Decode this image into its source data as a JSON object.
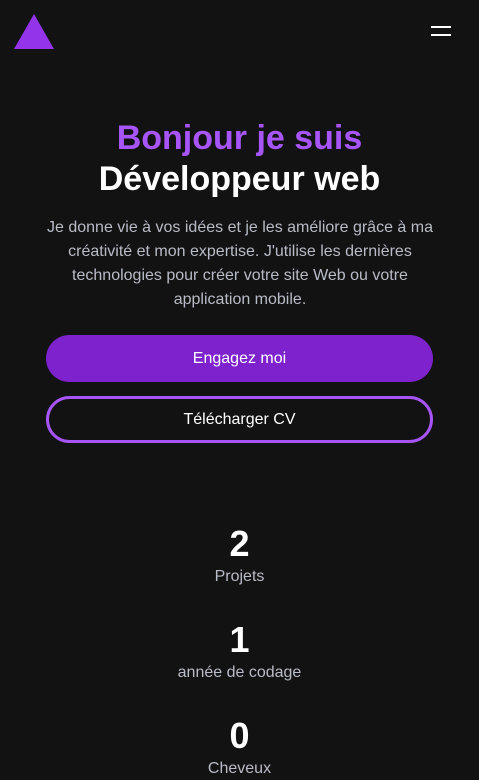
{
  "header": {
    "menu_icon": "hamburger-icon",
    "logo_icon": "triangle-logo",
    "accent": "#9333ea"
  },
  "hero": {
    "greeting": "Bonjour je suis",
    "role": "Développeur web",
    "description": "Je donne vie à vos idées et je les améliore grâce à ma créativité et mon expertise. J'utilise les dernières technologies pour créer votre site Web ou votre application mobile.",
    "hire_label": "Engagez moi",
    "cv_label": "Télécharger CV"
  },
  "stats": [
    {
      "value": "2",
      "label": "Projets"
    },
    {
      "value": "1",
      "label": "année de codage"
    },
    {
      "value": "0",
      "label": "Cheveux"
    }
  ]
}
